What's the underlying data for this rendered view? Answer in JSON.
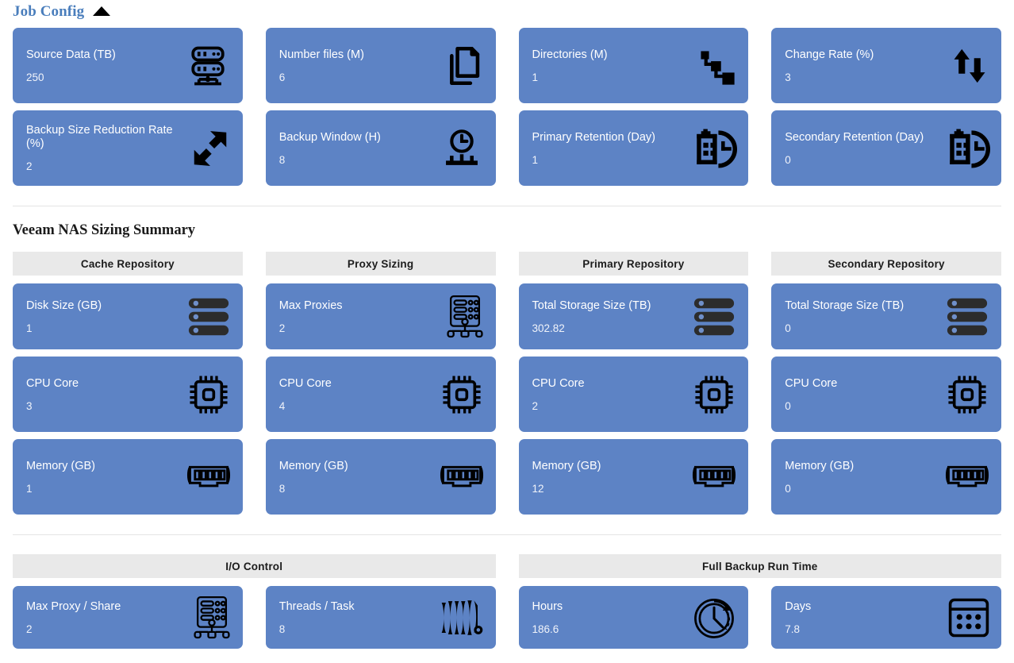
{
  "job_config": {
    "title": "Job Config",
    "collapse_icon": "caret-up-icon",
    "cards": [
      {
        "label": "Source Data (TB)",
        "value": "250",
        "icon": "server-rack-icon"
      },
      {
        "label": "Number files (M)",
        "value": "6",
        "icon": "documents-copy-icon"
      },
      {
        "label": "Directories (M)",
        "value": "1",
        "icon": "directory-tree-icon"
      },
      {
        "label": "Change Rate (%)",
        "value": "3",
        "icon": "up-down-arrows-icon"
      },
      {
        "label": "Backup Size Reduction Rate (%)",
        "value": "2",
        "icon": "compress-arrows-icon"
      },
      {
        "label": "Backup Window (H)",
        "value": "8",
        "icon": "clock-stand-icon"
      },
      {
        "label": "Primary Retention (Day)",
        "value": "1",
        "icon": "calendar-clock-icon"
      },
      {
        "label": "Secondary Retention (Day)",
        "value": "0",
        "icon": "calendar-clock-icon"
      }
    ]
  },
  "summary": {
    "title": "Veeam NAS Sizing Summary",
    "columns": [
      {
        "header": "Cache Repository",
        "cards": [
          {
            "label": "Disk Size (GB)",
            "value": "1",
            "icon": "disk-stack-icon"
          },
          {
            "label": "CPU Core",
            "value": "3",
            "icon": "cpu-chip-icon"
          },
          {
            "label": "Memory (GB)",
            "value": "1",
            "icon": "memory-ram-icon"
          }
        ]
      },
      {
        "header": "Proxy Sizing",
        "cards": [
          {
            "label": "Max Proxies",
            "value": "2",
            "icon": "proxy-server-icon"
          },
          {
            "label": "CPU Core",
            "value": "4",
            "icon": "cpu-chip-icon"
          },
          {
            "label": "Memory (GB)",
            "value": "8",
            "icon": "memory-ram-icon"
          }
        ]
      },
      {
        "header": "Primary Repository",
        "cards": [
          {
            "label": "Total Storage Size (TB)",
            "value": "302.82",
            "icon": "disk-stack-icon"
          },
          {
            "label": "CPU Core",
            "value": "2",
            "icon": "cpu-chip-icon"
          },
          {
            "label": "Memory (GB)",
            "value": "12",
            "icon": "memory-ram-icon"
          }
        ]
      },
      {
        "header": "Secondary Repository",
        "cards": [
          {
            "label": "Total Storage Size (TB)",
            "value": "0",
            "icon": "disk-stack-icon"
          },
          {
            "label": "CPU Core",
            "value": "0",
            "icon": "cpu-chip-icon"
          },
          {
            "label": "Memory (GB)",
            "value": "0",
            "icon": "memory-ram-icon"
          }
        ]
      }
    ]
  },
  "bottom": {
    "columns": [
      {
        "header": "I/O Control",
        "cards": [
          {
            "label": "Max Proxy / Share",
            "value": "2",
            "icon": "proxy-server-icon"
          },
          {
            "label": "Threads / Task",
            "value": "8",
            "icon": "threads-bellows-icon"
          }
        ]
      },
      {
        "header": "Full Backup Run Time",
        "cards": [
          {
            "label": "Hours",
            "value": "186.6",
            "icon": "clock-arrow-icon"
          },
          {
            "label": "Days",
            "value": "7.8",
            "icon": "calendar-grid-icon"
          }
        ]
      }
    ]
  },
  "colors": {
    "card_background": "#5d83c5",
    "header_band": "#e9e9e9",
    "job_title": "#4a7ebc",
    "page_background": "#ffffff",
    "icon": "#000000",
    "divider": "#e4e4e4"
  }
}
